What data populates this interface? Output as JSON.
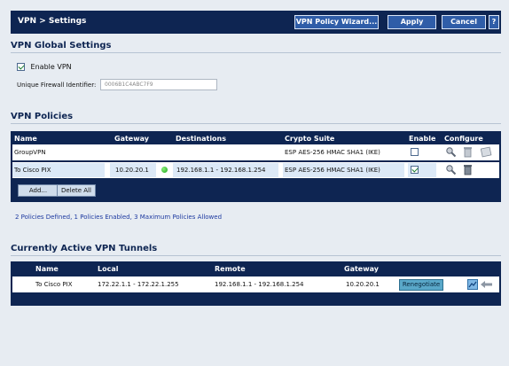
{
  "header": {
    "title": "VPN > Settings",
    "wizard_label": "VPN Policy Wizard...",
    "apply_label": "Apply",
    "cancel_label": "Cancel",
    "help_label": "?"
  },
  "global": {
    "title": "VPN Global Settings",
    "enable_label": "Enable VPN",
    "enable_checked": true,
    "ufi_label": "Unique Firewall Identifier:",
    "ufi_value": "0006B1C4ABC7F9"
  },
  "policies": {
    "title": "VPN Policies",
    "columns": {
      "name": "Name",
      "gateway": "Gateway",
      "destinations": "Destinations",
      "crypto": "Crypto Suite",
      "enable": "Enable",
      "configure": "Configure"
    },
    "rows": [
      {
        "name": "GroupVPN",
        "gateway": "",
        "destinations": "",
        "crypto": "ESP AES-256 HMAC SHA1 (IKE)",
        "enabled": false,
        "status": "none"
      },
      {
        "name": "To Cisco PIX",
        "gateway": "10.20.20.1",
        "destinations": "192.168.1.1 - 192.168.1.254",
        "crypto": "ESP AES-256 HMAC SHA1 (IKE)",
        "enabled": true,
        "status": "up"
      }
    ],
    "add_label": "Add...",
    "delete_all_label": "Delete All",
    "summary": "2 Policies Defined, 1 Policies Enabled, 3 Maximum Policies Allowed"
  },
  "tunnels": {
    "title": "Currently Active VPN Tunnels",
    "columns": {
      "name": "Name",
      "local": "Local",
      "remote": "Remote",
      "gateway": "Gateway"
    },
    "rows": [
      {
        "name": "To Cisco PIX",
        "local": "172.22.1.1 - 172.22.1.255",
        "remote": "192.168.1.1 - 192.168.1.254",
        "gateway": "10.20.20.1",
        "action": "Renegotiate"
      }
    ]
  },
  "colors": {
    "navy": "#0e2552",
    "page_bg": "#e7ecf2",
    "button_blue": "#2f5da8",
    "highlight": "#dce9f7",
    "status_green": "#19a51c"
  }
}
